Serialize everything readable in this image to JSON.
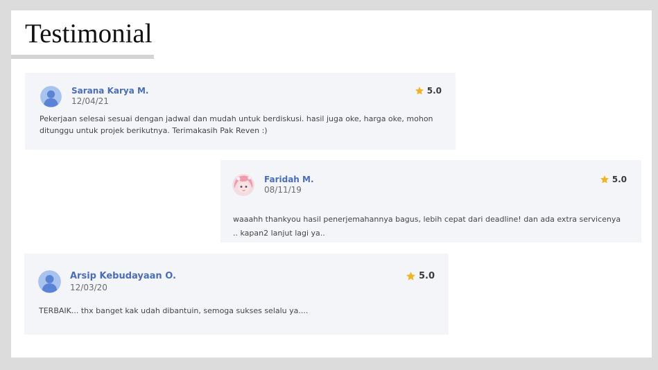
{
  "page": {
    "title": "Testimonial"
  },
  "testimonials": [
    {
      "name": "Sarana Karya M.",
      "date": "12/04/21",
      "rating": "5.0",
      "avatar": "default-user-icon",
      "comment": "Pekerjaan selesai sesuai dengan jadwal dan mudah untuk berdiskusi. hasil juga oke, harga oke, mohon ditunggu untuk projek berikutnya. Terimakasih Pak Reven :)"
    },
    {
      "name": "Faridah M.",
      "date": "08/11/19",
      "rating": "5.0",
      "avatar": "anime-girl-avatar",
      "comment": "waaahh thankyou hasil penerjemahannya bagus, lebih cepat dari deadline! dan ada extra servicenya .. kapan2 lanjut lagi ya.."
    },
    {
      "name": "Arsip Kebudayaan O.",
      "date": "12/03/20",
      "rating": "5.0",
      "avatar": "default-user-icon",
      "comment": "TERBAIK... thx banget kak udah dibantuin, semoga  sukses selalu ya...."
    }
  ],
  "colors": {
    "card_background": "#f4f5f8",
    "name": "#4a6eb5",
    "star": "#f0b323",
    "avatar_bg": "#a9c3ef",
    "avatar_fg": "#5a83d6"
  }
}
